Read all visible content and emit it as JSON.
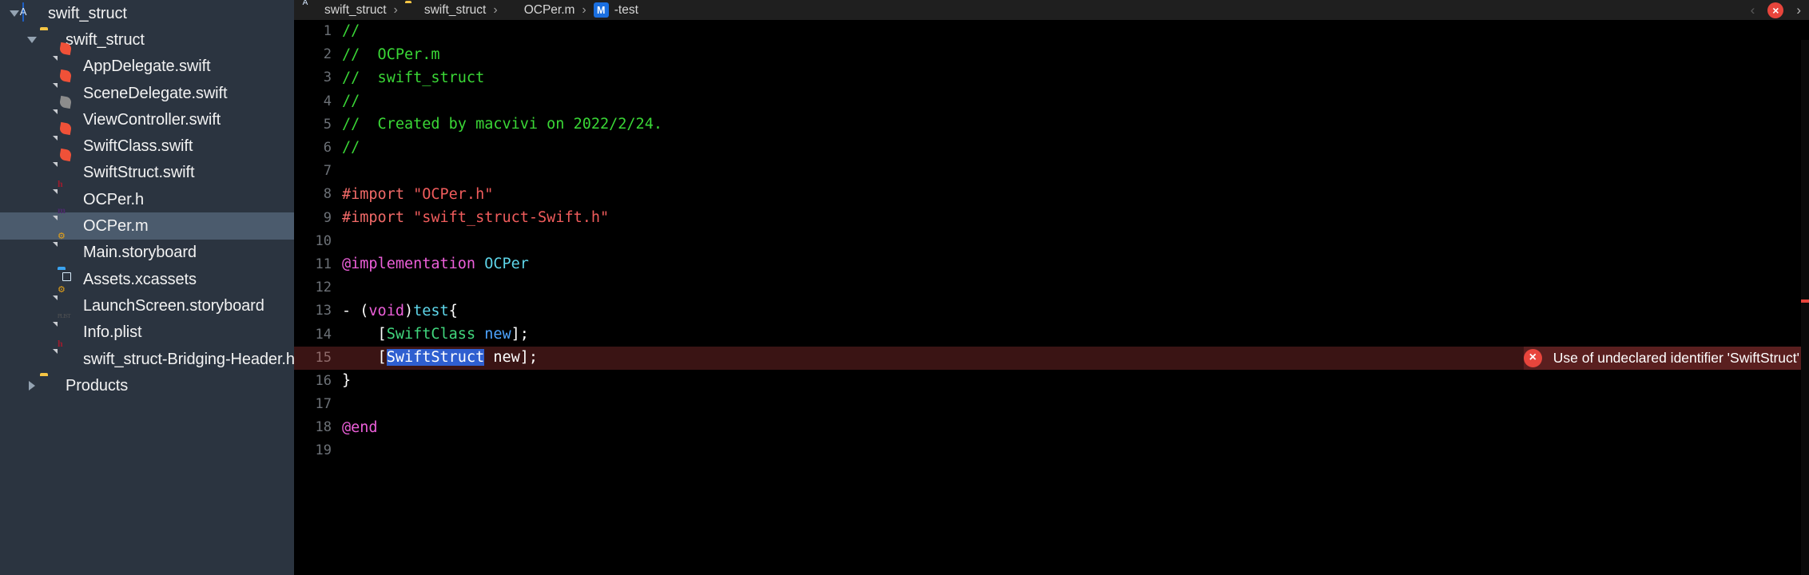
{
  "app": {
    "name": "Xcode"
  },
  "sidebar": {
    "items": [
      {
        "label": "swift_struct",
        "icon": "app-project-icon",
        "indent": 0,
        "disclosure": "open",
        "selected": false
      },
      {
        "label": "swift_struct",
        "icon": "folder-icon",
        "indent": 1,
        "disclosure": "open",
        "selected": false
      },
      {
        "label": "AppDelegate.swift",
        "icon": "swift-file-icon",
        "indent": 2,
        "disclosure": "none",
        "selected": false
      },
      {
        "label": "SceneDelegate.swift",
        "icon": "swift-file-icon",
        "indent": 2,
        "disclosure": "none",
        "selected": false
      },
      {
        "label": "ViewController.swift",
        "icon": "swift-file-icon-grey",
        "indent": 2,
        "disclosure": "none",
        "selected": false
      },
      {
        "label": "SwiftClass.swift",
        "icon": "swift-file-icon",
        "indent": 2,
        "disclosure": "none",
        "selected": false
      },
      {
        "label": "SwiftStruct.swift",
        "icon": "swift-file-icon",
        "indent": 2,
        "disclosure": "none",
        "selected": false
      },
      {
        "label": "OCPer.h",
        "icon": "header-file-icon",
        "indent": 2,
        "disclosure": "none",
        "selected": false
      },
      {
        "label": "OCPer.m",
        "icon": "objc-file-icon",
        "indent": 2,
        "disclosure": "none",
        "selected": true
      },
      {
        "label": "Main.storyboard",
        "icon": "storyboard-file-icon",
        "indent": 2,
        "disclosure": "none",
        "selected": false
      },
      {
        "label": "Assets.xcassets",
        "icon": "xcassets-folder-icon",
        "indent": 2,
        "disclosure": "none",
        "selected": false
      },
      {
        "label": "LaunchScreen.storyboard",
        "icon": "storyboard-file-icon",
        "indent": 2,
        "disclosure": "none",
        "selected": false
      },
      {
        "label": "Info.plist",
        "icon": "plist-file-icon",
        "indent": 2,
        "disclosure": "none",
        "selected": false
      },
      {
        "label": "swift_struct-Bridging-Header.h",
        "icon": "header-file-icon",
        "indent": 2,
        "disclosure": "none",
        "selected": false
      },
      {
        "label": "Products",
        "icon": "folder-icon",
        "indent": 1,
        "disclosure": "closed",
        "selected": false
      }
    ]
  },
  "jumpbar": {
    "crumbs": [
      {
        "label": "swift_struct",
        "icon": "app-project-icon"
      },
      {
        "label": "swift_struct",
        "icon": "folder-icon"
      },
      {
        "label": "OCPer.m",
        "icon": "objc-file-icon"
      },
      {
        "label": "-test",
        "icon": "method-badge-icon",
        "badge": "M"
      }
    ],
    "separator": "›",
    "prev_label": "‹",
    "next_label": "›",
    "issue_badge": "×"
  },
  "editor": {
    "lines": [
      {
        "number": "1",
        "tokens": [
          {
            "t": "//",
            "c": "cm"
          }
        ]
      },
      {
        "number": "2",
        "tokens": [
          {
            "t": "//  OCPer.m",
            "c": "cm"
          }
        ]
      },
      {
        "number": "3",
        "tokens": [
          {
            "t": "//  swift_struct",
            "c": "cm"
          }
        ]
      },
      {
        "number": "4",
        "tokens": [
          {
            "t": "//",
            "c": "cm"
          }
        ]
      },
      {
        "number": "5",
        "tokens": [
          {
            "t": "//  Created by macvivi on 2022/2/24.",
            "c": "cm"
          }
        ]
      },
      {
        "number": "6",
        "tokens": [
          {
            "t": "//",
            "c": "cm"
          }
        ]
      },
      {
        "number": "7",
        "tokens": []
      },
      {
        "number": "8",
        "tokens": [
          {
            "t": "#import ",
            "c": "pp"
          },
          {
            "t": "\"OCPer.h\"",
            "c": "str"
          }
        ]
      },
      {
        "number": "9",
        "tokens": [
          {
            "t": "#import ",
            "c": "pp"
          },
          {
            "t": "\"swift_struct-Swift.h\"",
            "c": "str"
          }
        ]
      },
      {
        "number": "10",
        "tokens": []
      },
      {
        "number": "11",
        "tokens": [
          {
            "t": "@implementation ",
            "c": "kw"
          },
          {
            "t": "OCPer",
            "c": "typ"
          }
        ]
      },
      {
        "number": "12",
        "tokens": []
      },
      {
        "number": "13",
        "tokens": [
          {
            "t": "- (",
            "c": "pl"
          },
          {
            "t": "void",
            "c": "kw"
          },
          {
            "t": ")",
            "c": "pl"
          },
          {
            "t": "test",
            "c": "typ"
          },
          {
            "t": "{",
            "c": "pl"
          }
        ]
      },
      {
        "number": "14",
        "tokens": [
          {
            "t": "    [",
            "c": "pl"
          },
          {
            "t": "SwiftClass",
            "c": "cls"
          },
          {
            "t": " ",
            "c": "pl"
          },
          {
            "t": "new",
            "c": "msg"
          },
          {
            "t": "];",
            "c": "pl"
          }
        ]
      },
      {
        "number": "15",
        "tokens": [
          {
            "t": "    [",
            "c": "pl"
          },
          {
            "t": "SwiftStruct",
            "c": "sel"
          },
          {
            "t": " new];",
            "c": "pl"
          }
        ],
        "error": true
      },
      {
        "number": "16",
        "tokens": [
          {
            "t": "}",
            "c": "pl"
          }
        ]
      },
      {
        "number": "17",
        "tokens": []
      },
      {
        "number": "18",
        "tokens": [
          {
            "t": "@end",
            "c": "kw"
          }
        ]
      },
      {
        "number": "19",
        "tokens": []
      }
    ],
    "error": {
      "line": "15",
      "message": "Use of undeclared identifier 'SwiftStruct'",
      "icon_glyph": "×",
      "color": "#e8453c"
    }
  },
  "colors": {
    "sidebar_bg": "#2b3440",
    "sidebar_selected": "#4b5b6d",
    "editor_bg": "#000000",
    "comment": "#3ad736",
    "preprocessor": "#f26a68",
    "string": "#f05c5c",
    "keyword": "#ec5fd9",
    "type": "#5ed6ea",
    "class": "#41d67d",
    "message": "#4da3ff",
    "error_row_bg": "#3a1414",
    "error_banner_bg": "#5a1f1f",
    "selection": "#2f5fd0"
  }
}
